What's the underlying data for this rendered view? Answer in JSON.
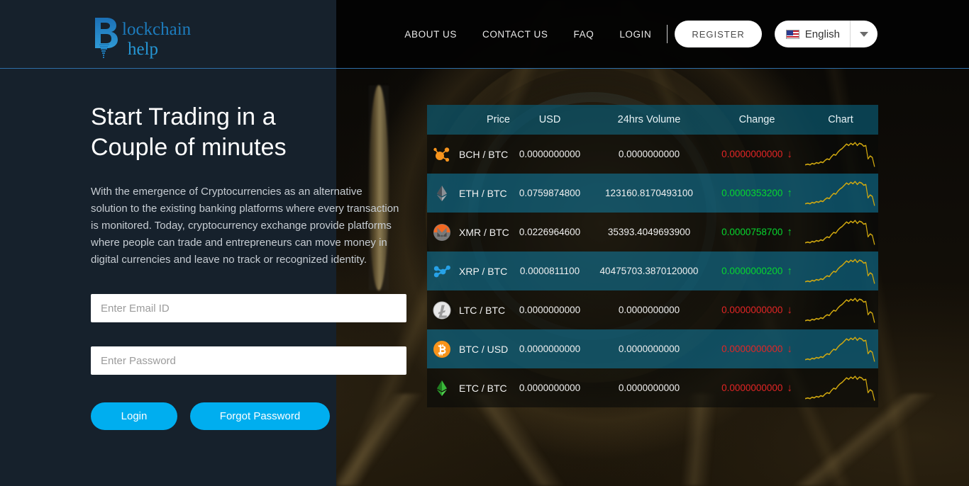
{
  "brand": {
    "name_line1": "lockchain",
    "name_line2": "help",
    "initial": "B"
  },
  "nav": {
    "links": [
      {
        "label": "ABOUT US",
        "name": "nav-about-us"
      },
      {
        "label": "CONTACT US",
        "name": "nav-contact-us"
      },
      {
        "label": "FAQ",
        "name": "nav-faq"
      },
      {
        "label": "LOGIN",
        "name": "nav-login"
      }
    ],
    "register_label": "REGISTER",
    "language": {
      "label": "English",
      "icon": "us-flag-icon",
      "caret": "chevron-down-icon"
    }
  },
  "hero": {
    "title": "Start Trading in a Couple of minutes",
    "paragraph": "With the emergence of Cryptocurrencies as an alternative solution to the existing banking platforms where every transaction is monitored. Today, cryptocurrency exchange provide platforms where people can trade and entrepreneurs can move money in digital currencies and leave no track or recognized identity."
  },
  "form": {
    "email_placeholder": "Enter Email ID",
    "email_value": "",
    "password_placeholder": "Enter Password",
    "password_value": "",
    "login_label": "Login",
    "forgot_label": "Forgot Password"
  },
  "ticker": {
    "columns": [
      "Price",
      "USD",
      "24hrs Volume",
      "Change",
      "Chart"
    ],
    "rows": [
      {
        "pair": "BCH / BTC",
        "icon": "bch-icon",
        "usd": "0.0000000000",
        "volume": "0.0000000000",
        "change": "0.0000000000",
        "dir": "down"
      },
      {
        "pair": "ETH / BTC",
        "icon": "eth-icon",
        "usd": "0.0759874800",
        "volume": "123160.8170493100",
        "change": "0.0000353200",
        "dir": "up"
      },
      {
        "pair": "XMR / BTC",
        "icon": "xmr-icon",
        "usd": "0.0226964600",
        "volume": "35393.4049693900",
        "change": "0.0000758700",
        "dir": "up"
      },
      {
        "pair": "XRP / BTC",
        "icon": "xrp-icon",
        "usd": "0.0000811100",
        "volume": "40475703.3870120000",
        "change": "0.0000000200",
        "dir": "up"
      },
      {
        "pair": "LTC / BTC",
        "icon": "ltc-icon",
        "usd": "0.0000000000",
        "volume": "0.0000000000",
        "change": "0.0000000000",
        "dir": "down"
      },
      {
        "pair": "BTC / USD",
        "icon": "btc-icon",
        "usd": "0.0000000000",
        "volume": "0.0000000000",
        "change": "0.0000000000",
        "dir": "down"
      },
      {
        "pair": "ETC / BTC",
        "icon": "etc-icon",
        "usd": "0.0000000000",
        "volume": "0.0000000000",
        "change": "0.0000000000",
        "dir": "down"
      }
    ],
    "arrow_up": "↑",
    "arrow_down": "↓"
  },
  "colors": {
    "accent_blue": "#00aeef",
    "panel_navy": "#16212c",
    "header_teal": "#0a566e",
    "row_teal": "#0c5a74",
    "up_green": "#07d62e",
    "down_red": "#e32525",
    "spark_gold": "#d2a90f"
  }
}
